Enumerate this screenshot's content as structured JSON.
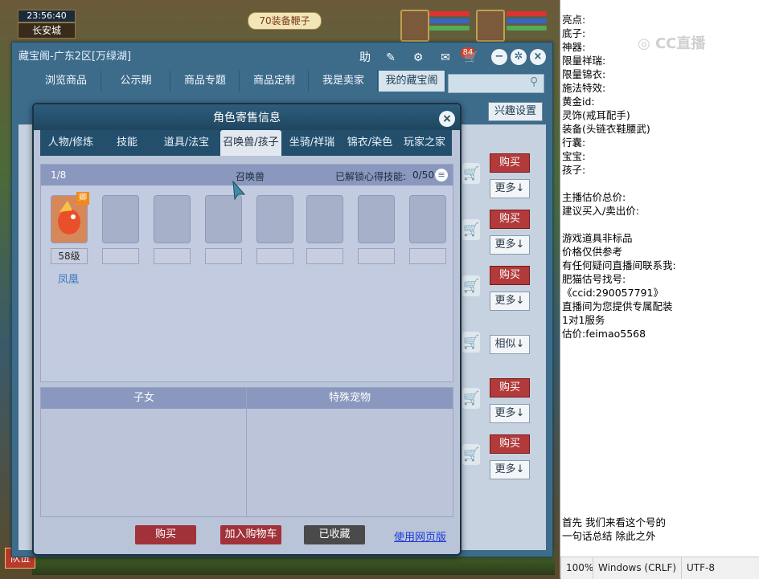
{
  "game": {
    "clock": "23:56:40",
    "city": "长安城",
    "quest_banner": "70装备鞭子",
    "team_button": "队伍"
  },
  "shop": {
    "title": "藏宝阁-广东2区[万绿湖]",
    "help_label": "助",
    "message_count": "84",
    "nav_tabs": [
      "浏览商品",
      "公示期",
      "商品专题",
      "商品定制",
      "我是卖家",
      "我的藏宝阁"
    ],
    "active_nav": "我的藏宝阁",
    "interest_label": "兴趣设置",
    "buy_label": "购买",
    "more_label": "更多↓",
    "similar_label": "相似↓"
  },
  "dialog": {
    "title": "角色寄售信息",
    "tabs": [
      "人物/修炼",
      "技能",
      "道具/法宝",
      "召唤兽/孩子",
      "坐骑/祥瑞",
      "锦衣/染色",
      "玩家之家"
    ],
    "active_tab": "召唤兽/孩子",
    "pet_page": "1/8",
    "pet_header": "召唤兽",
    "skill_unlock_label": "已解锁心得技能:",
    "skill_unlock_value": "0/50",
    "pet_level": "58级",
    "pet_name": "凤凰",
    "pet_badge": "卿",
    "children_header": "子女",
    "special_pet_header": "特殊宠物",
    "buy_button": "购买",
    "add_cart_button": "加入购物车",
    "collected_button": "已收藏",
    "web_version_link": "使用网页版"
  },
  "notepad": {
    "lines": [
      "亮点:",
      "底子:",
      "神器:",
      "限量祥瑞:",
      "限量锦衣:",
      "施法特效:",
      "黄金id:",
      "灵饰(戒耳配手)",
      "装备(头链衣鞋腰武)",
      "行囊:",
      "宝宝:",
      "孩子:",
      "",
      "主播估价总价:",
      "建议买入/卖出价:",
      "",
      "游戏道具非标品",
      "价格仅供参考",
      "有任何疑问直播间联系我:",
      "肥猫估号找号:",
      "《ccid:290057791》",
      "直播间为您提供专属配装",
      "1对1服务",
      "估价:feimao5568"
    ],
    "bottom_lines": [
      "首先 我们来看这个号的",
      "一句话总结 除此之外"
    ],
    "status": {
      "zoom": "100%",
      "line_ending": "Windows (CRLF)",
      "encoding": "UTF-8"
    }
  },
  "colors": {
    "accent": "#2d5d7c",
    "buy": "#b23a3a",
    "link": "#1a3adc"
  }
}
